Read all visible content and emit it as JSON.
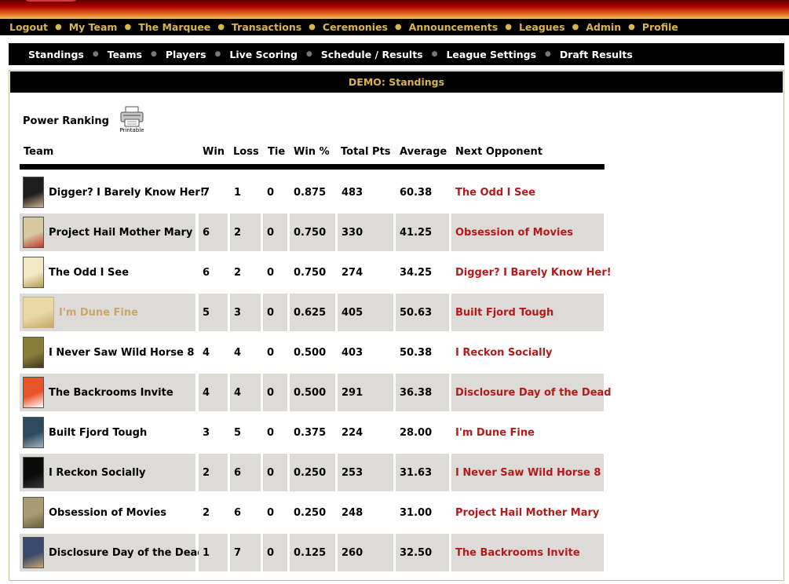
{
  "nav": {
    "main": [
      "Logout",
      "My Team",
      "The Marquee",
      "Transactions",
      "Ceremonies",
      "Announcements",
      "Leagues",
      "Admin",
      "Profile"
    ],
    "sub": [
      "Standings",
      "Teams",
      "Players",
      "Live Scoring",
      "Schedule / Results",
      "League Settings",
      "Draft Results"
    ]
  },
  "panel": {
    "title": "DEMO: Standings",
    "power_ranking_label": "Power Ranking",
    "printable_label": "Printable"
  },
  "table": {
    "headers": {
      "team": "Team",
      "win": "Win",
      "loss": "Loss",
      "tie": "Tie",
      "pct": "Win %",
      "pts": "Total Pts",
      "avg": "Average",
      "opp": "Next Opponent"
    },
    "rows": [
      {
        "team": "Digger? I Barely Know Her!",
        "win": "7",
        "loss": "1",
        "tie": "0",
        "pct": "0.875",
        "pts": "483",
        "avg": "60.38",
        "opp": "The Odd I See",
        "poster": "#1e1e1e",
        "poster2": "#d2b08f"
      },
      {
        "team": "Project Hail Mother Mary",
        "win": "6",
        "loss": "2",
        "tie": "0",
        "pct": "0.750",
        "pts": "330",
        "avg": "41.25",
        "opp": "Obsession of Movies",
        "poster": "#d7c8a0",
        "poster2": "#c03a2a"
      },
      {
        "team": "The Odd I See",
        "win": "6",
        "loss": "2",
        "tie": "0",
        "pct": "0.750",
        "pts": "274",
        "avg": "34.25",
        "opp": "Digger? I Barely Know Her!",
        "poster": "#f3e8c6",
        "poster2": "#b89a55"
      },
      {
        "team": "I'm Dune Fine",
        "win": "5",
        "loss": "3",
        "tie": "0",
        "pct": "0.625",
        "pts": "405",
        "avg": "50.63",
        "opp": "Built Fjord Tough",
        "poster": "#e9d7a6",
        "poster2": "#c8a765"
      },
      {
        "team": "I Never Saw Wild Horse 8",
        "win": "4",
        "loss": "4",
        "tie": "0",
        "pct": "0.500",
        "pts": "403",
        "avg": "50.38",
        "opp": "I Reckon Socially",
        "poster": "#8a7d3a",
        "poster2": "#3e3a20"
      },
      {
        "team": "The Backrooms Invite",
        "win": "4",
        "loss": "4",
        "tie": "0",
        "pct": "0.500",
        "pts": "291",
        "avg": "36.38",
        "opp": "Disclosure Day of the Dead",
        "poster": "#e8542a",
        "poster2": "#ffffff"
      },
      {
        "team": "Built Fjord Tough",
        "win": "3",
        "loss": "5",
        "tie": "0",
        "pct": "0.375",
        "pts": "224",
        "avg": "28.00",
        "opp": "I'm Dune Fine",
        "poster": "#2f4a5e",
        "poster2": "#9fb4c4"
      },
      {
        "team": "I Reckon Socially",
        "win": "2",
        "loss": "6",
        "tie": "0",
        "pct": "0.250",
        "pts": "253",
        "avg": "31.63",
        "opp": "I Never Saw Wild Horse 8",
        "poster": "#0a0a0a",
        "poster2": "#333333"
      },
      {
        "team": "Obsession of Movies",
        "win": "2",
        "loss": "6",
        "tie": "0",
        "pct": "0.250",
        "pts": "248",
        "avg": "31.00",
        "opp": "Project Hail Mother Mary",
        "poster": "#a89a72",
        "poster2": "#6a5d3c"
      },
      {
        "team": "Disclosure Day of the Dead",
        "win": "1",
        "loss": "7",
        "tie": "0",
        "pct": "0.125",
        "pts": "260",
        "avg": "32.50",
        "opp": "The Backrooms Invite",
        "poster": "#3a4a6a",
        "poster2": "#c9a46a"
      }
    ]
  },
  "colors": {
    "accent_gold": "#d9b54a",
    "link_red": "#b51a1a",
    "row_shade": "#dddbd7"
  }
}
